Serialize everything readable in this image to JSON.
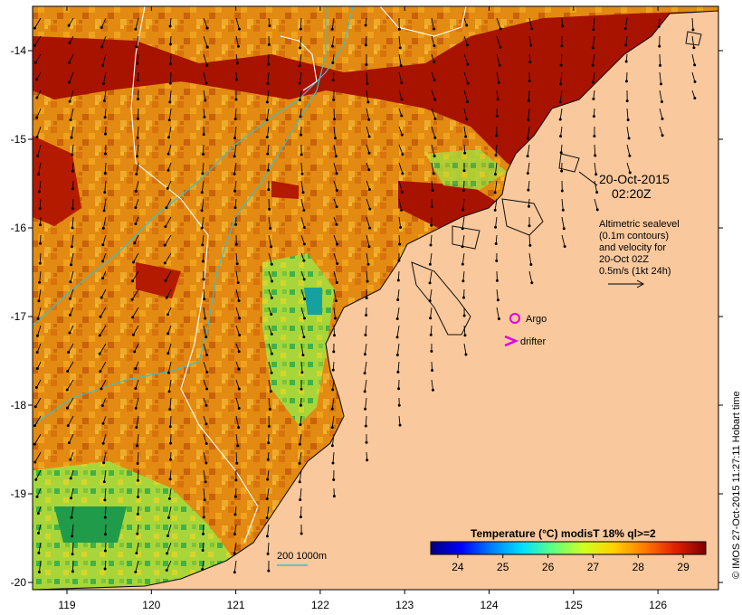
{
  "map": {
    "lon_ticks": [
      "119",
      "120",
      "121",
      "122",
      "123",
      "124",
      "125",
      "126"
    ],
    "lat_ticks": [
      "-14",
      "-15",
      "-16",
      "-17",
      "-18",
      "-19",
      "-20"
    ]
  },
  "annotations": {
    "date_line1": "20-Oct-2015",
    "date_line2": "02:20Z",
    "alt_line1": "Altimetric sealevel",
    "alt_line2": "(0.1m contours)",
    "alt_line3": "and velocity for",
    "alt_line4": "20-Oct 02Z",
    "alt_line5": "0.5m/s (1kt 24h)"
  },
  "legend": {
    "argo": "Argo",
    "drifter": "drifter",
    "depth": "200  1000m"
  },
  "colorbar": {
    "title": "Temperature (°C) modisT 18% ql>=2",
    "ticks": [
      "24",
      "25",
      "26",
      "27",
      "28",
      "29"
    ],
    "value_min": 23.4,
    "value_max": 29.5,
    "colors": [
      "#00007f",
      "#0000ff",
      "#0080ff",
      "#00e0ff",
      "#60ff80",
      "#d0ff20",
      "#ffd000",
      "#ff7a00",
      "#e02000",
      "#7f0000"
    ]
  },
  "credit": "© IMOS 27-Oct-2015 11:27:11 Hobart time",
  "colors": {
    "land": "#f9c89c",
    "warm": "#e58a10",
    "hot": "#a81300",
    "cool": "#9fd83a",
    "cold": "#1f9b4a",
    "contour_sealevel": "#ffffff",
    "contour_depth": "#3cc0c8",
    "argo": "#e000e0",
    "drifter": "#e000e0"
  }
}
